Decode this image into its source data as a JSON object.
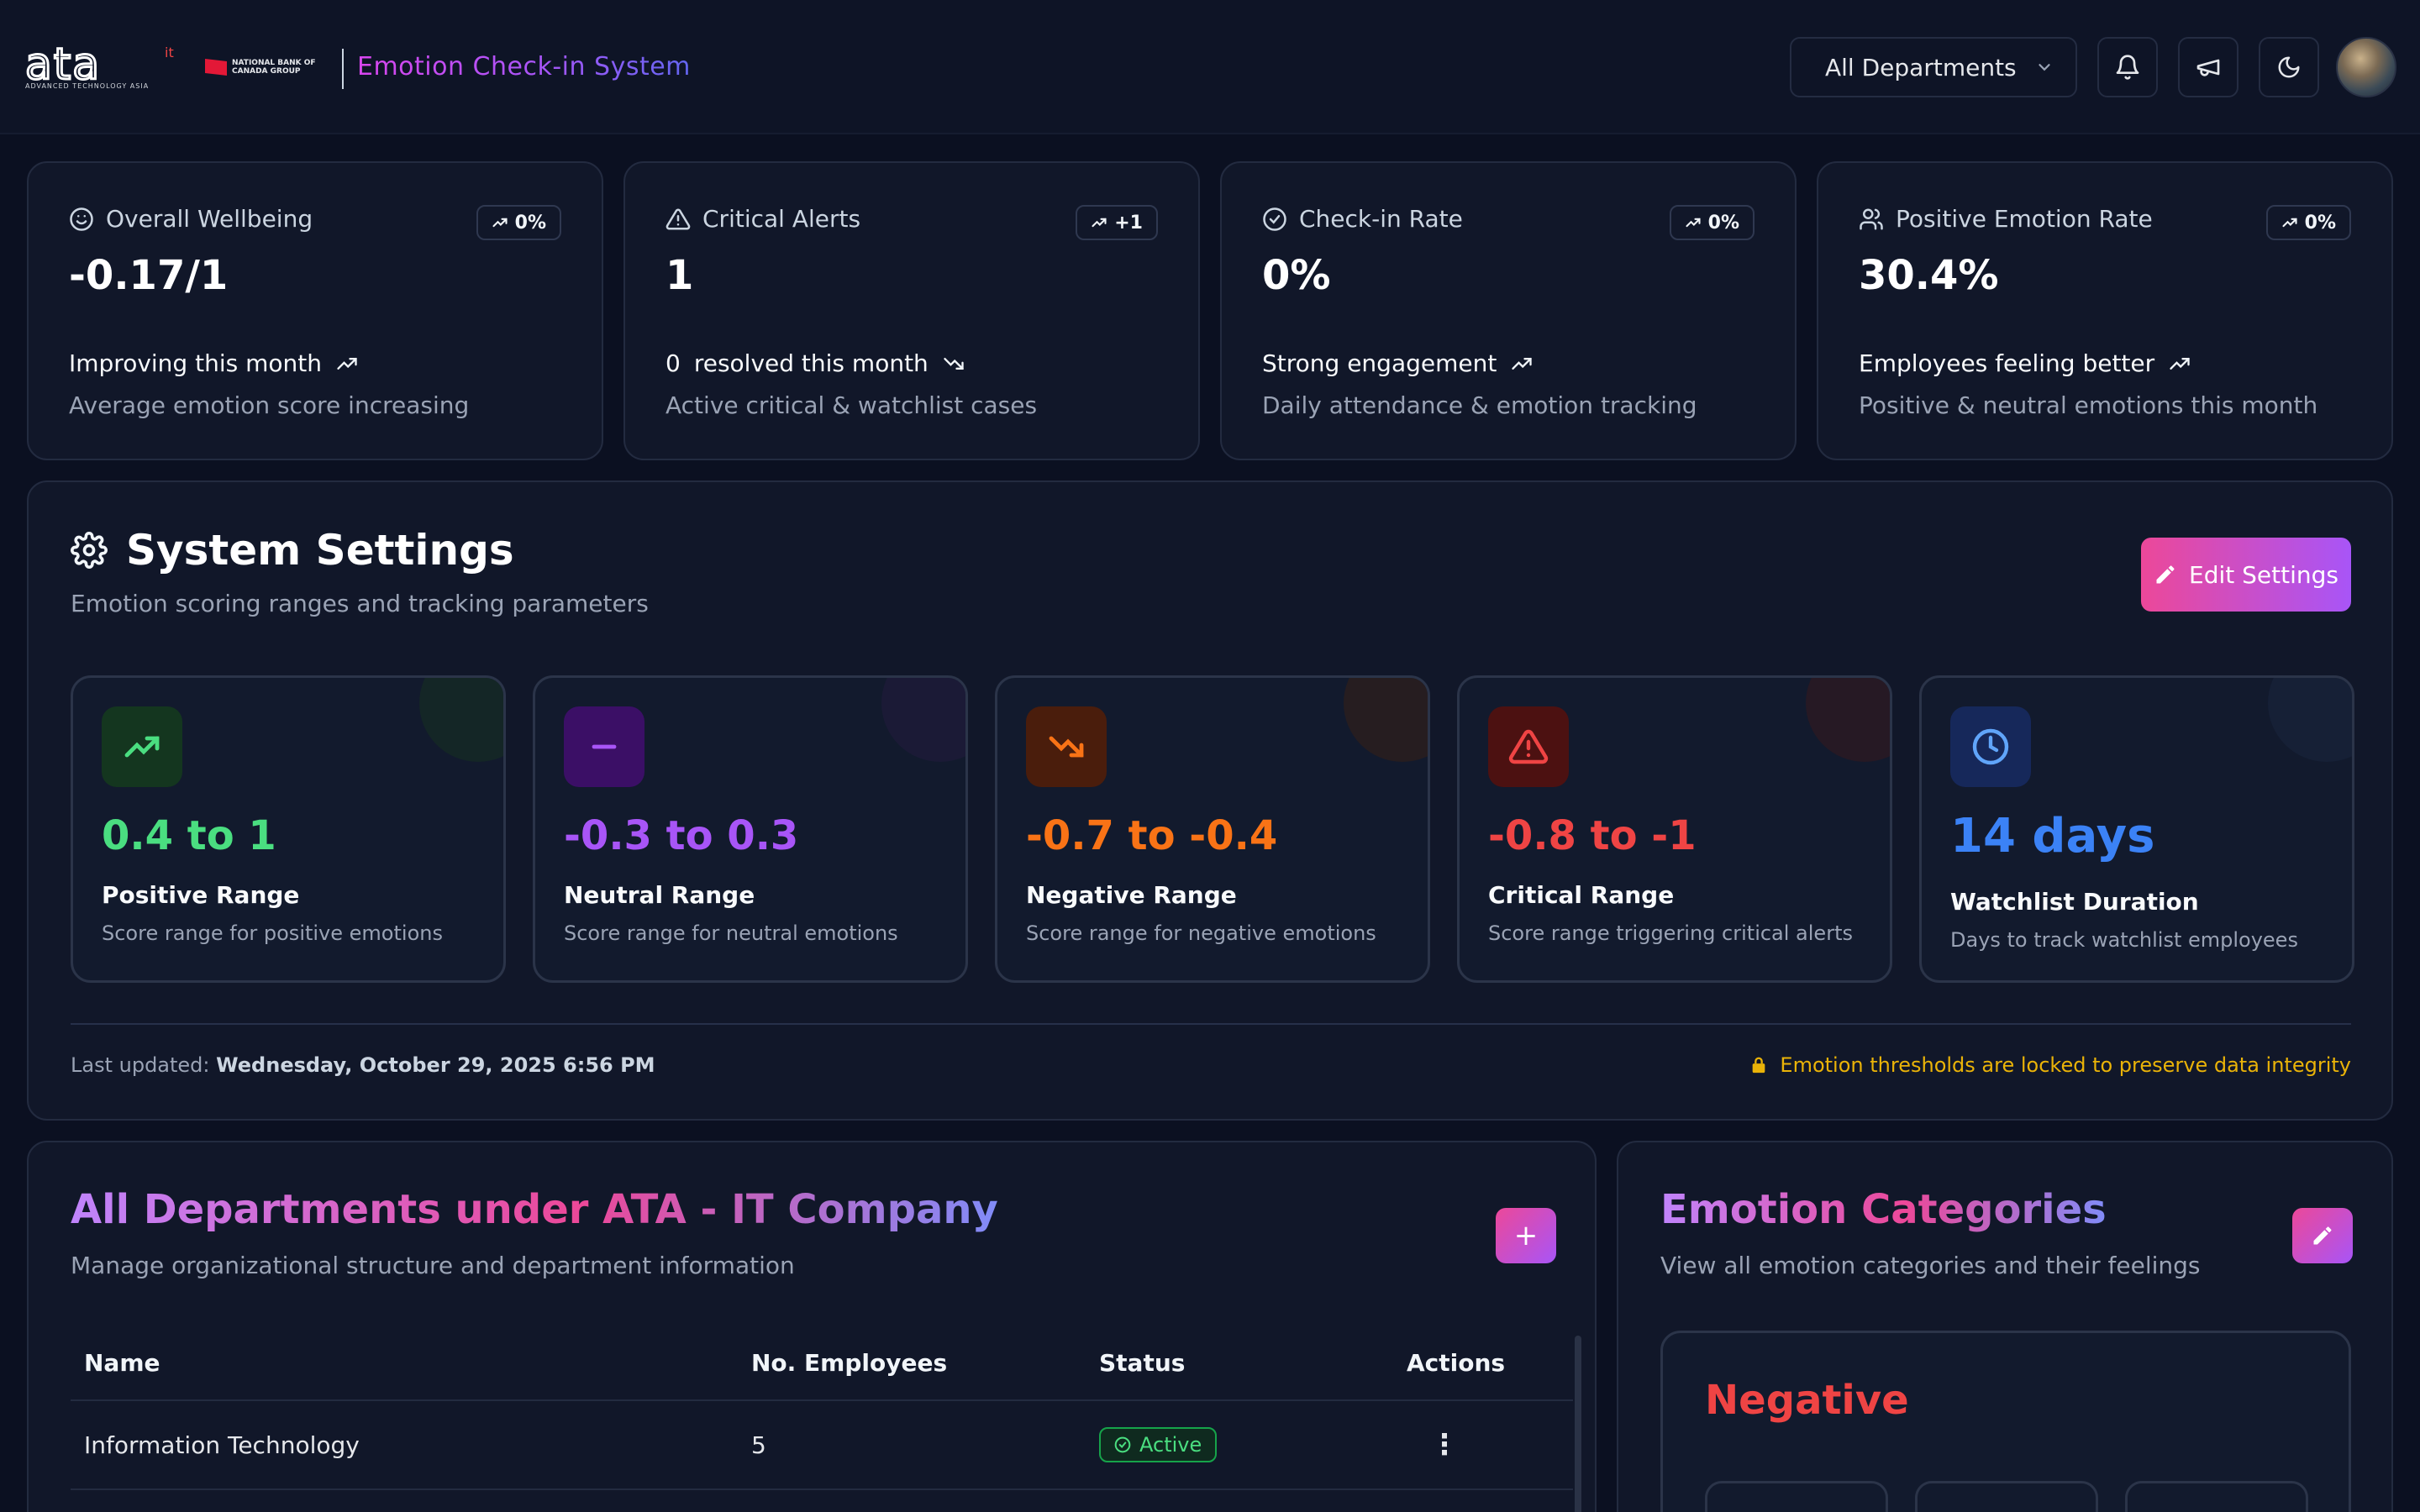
{
  "header": {
    "brand_logo_text": "ata",
    "brand_logo_super": "it",
    "brand_tagline": "ADVANCED TECHNOLOGY ASIA",
    "partner_logo_text": "NATIONAL BANK OF CANADA GROUP",
    "system_title": "Emotion Check-in System",
    "department_select": "All Departments"
  },
  "stats": [
    {
      "title": "Overall Wellbeing",
      "icon": "smile-icon",
      "badge": "0%",
      "value": "-0.17/1",
      "trend_prefix": "",
      "trend": "Improving this month",
      "trend_dir": "up",
      "description": "Average emotion score increasing"
    },
    {
      "title": "Critical Alerts",
      "icon": "alert-triangle-icon",
      "badge": "+1",
      "value": "1",
      "trend_prefix": "0",
      "trend": "resolved this month",
      "trend_dir": "down",
      "description": "Active critical & watchlist cases"
    },
    {
      "title": "Check-in Rate",
      "icon": "check-circle-icon",
      "badge": "0%",
      "value": "0%",
      "trend_prefix": "",
      "trend": "Strong engagement",
      "trend_dir": "up",
      "description": "Daily attendance & emotion tracking"
    },
    {
      "title": "Positive Emotion Rate",
      "icon": "users-icon",
      "badge": "0%",
      "value": "30.4%",
      "trend_prefix": "",
      "trend": "Employees feeling better",
      "trend_dir": "up",
      "description": "Positive & neutral emotions this month"
    }
  ],
  "settings": {
    "title": "System Settings",
    "subtitle": "Emotion scoring ranges and tracking parameters",
    "edit_label": "Edit Settings",
    "ranges": [
      {
        "value": "0.4 to 1",
        "label": "Positive Range",
        "desc": "Score range for positive emotions",
        "color": "#4ade80",
        "icon": "trending-up-icon"
      },
      {
        "value": "-0.3 to 0.3",
        "label": "Neutral Range",
        "desc": "Score range for neutral emotions",
        "color": "#a855f7",
        "icon": "minus-icon"
      },
      {
        "value": "-0.7 to -0.4",
        "label": "Negative Range",
        "desc": "Score range for negative emotions",
        "color": "#f97316",
        "icon": "trending-down-icon"
      },
      {
        "value": "-0.8 to -1",
        "label": "Critical Range",
        "desc": "Score range triggering critical alerts",
        "color": "#ef4444",
        "icon": "alert-triangle-icon"
      },
      {
        "value": "14 days",
        "label": "Watchlist Duration",
        "desc": "Days to track watchlist employees",
        "color": "#3b82f6",
        "icon": "clock-icon"
      }
    ],
    "last_updated_label": "Last updated:",
    "last_updated_value": "Wednesday, October 29, 2025 6:56 PM",
    "locked_note": "Emotion thresholds are locked to preserve data integrity"
  },
  "departments": {
    "title": "All Departments under ATA - IT Company",
    "subtitle": "Manage organizational structure and department information",
    "add_label": "+",
    "columns": [
      "Name",
      "No. Employees",
      "Status",
      "Actions"
    ],
    "rows": [
      {
        "name": "Information Technology",
        "employees": "5",
        "status": "Active",
        "action": "⋮"
      }
    ]
  },
  "emotion_categories": {
    "title": "Emotion Categories",
    "subtitle": "View all emotion categories and their feelings",
    "first_category": "Negative"
  }
}
